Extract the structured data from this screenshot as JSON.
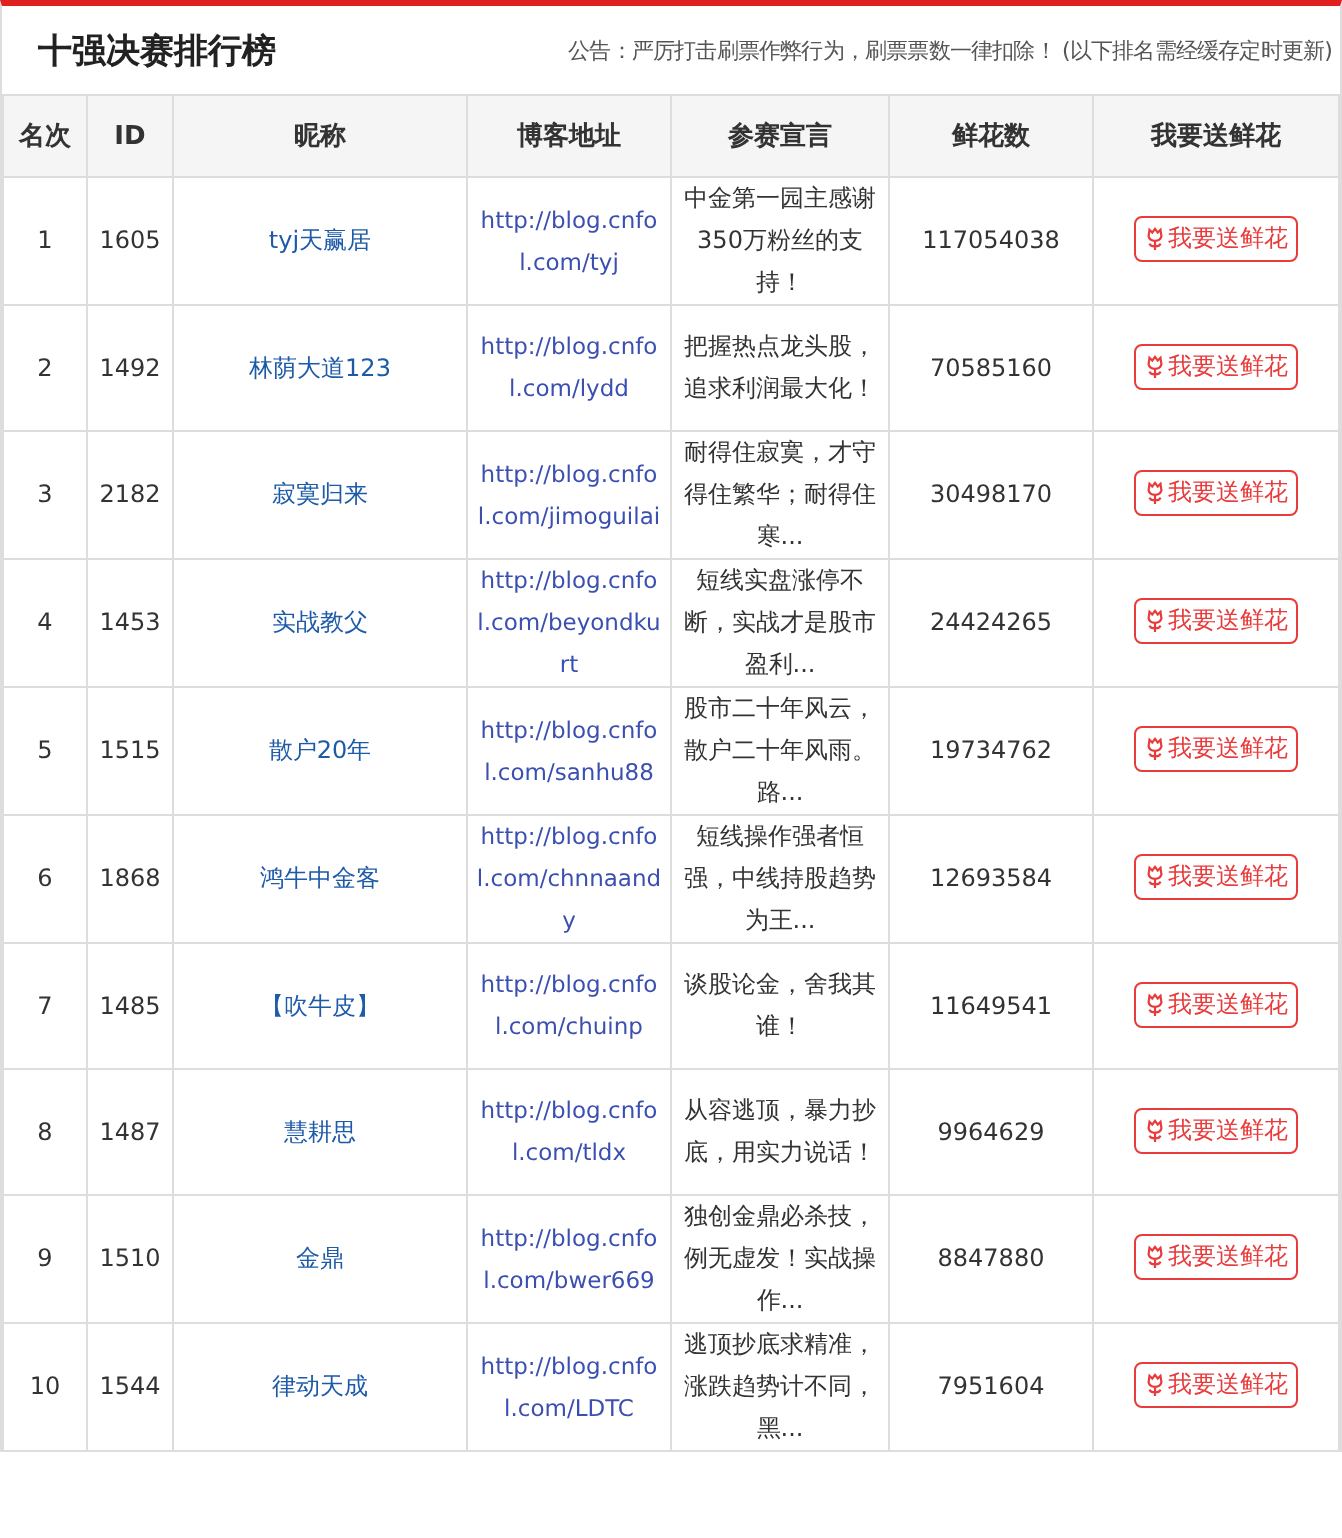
{
  "title": "十强决赛排行榜",
  "notice": "公告：严厉打击刷票作弊行为，刷票票数一律扣除！ (以下排名需经缓存定时更新)",
  "table": {
    "columns": [
      "名次",
      "ID",
      "昵称",
      "博客地址",
      "参赛宣言",
      "鲜花数",
      "我要送鲜花"
    ],
    "rows": [
      {
        "rank": "1",
        "id": "1605",
        "nickname": "tyj天赢居",
        "blog_url": "http://blog.cnfol.com/tyj",
        "declaration": "中金第一园主感谢350万粉丝的支持！",
        "flowers": "117054038",
        "action": "我要送鲜花"
      },
      {
        "rank": "2",
        "id": "1492",
        "nickname": "林荫大道123",
        "blog_url": "http://blog.cnfol.com/lydd",
        "declaration": "把握热点龙头股，追求利润最大化！",
        "flowers": "70585160",
        "action": "我要送鲜花"
      },
      {
        "rank": "3",
        "id": "2182",
        "nickname": "寂寞归来",
        "blog_url": "http://blog.cnfol.com/jimoguilai",
        "declaration": "耐得住寂寞，才守得住繁华；耐得住寒...",
        "flowers": "30498170",
        "action": "我要送鲜花"
      },
      {
        "rank": "4",
        "id": "1453",
        "nickname": "实战教父",
        "blog_url": "http://blog.cnfol.com/beyondkurt",
        "declaration": "短线实盘涨停不断，实战才是股市盈利...",
        "flowers": "24424265",
        "action": "我要送鲜花"
      },
      {
        "rank": "5",
        "id": "1515",
        "nickname": "散户20年",
        "blog_url": "http://blog.cnfol.com/sanhu88",
        "declaration": "股市二十年风云，散户二十年风雨。路...",
        "flowers": "19734762",
        "action": "我要送鲜花"
      },
      {
        "rank": "6",
        "id": "1868",
        "nickname": "鸿牛中金客",
        "blog_url": "http://blog.cnfol.com/chnnaandy",
        "declaration": "短线操作强者恒强，中线持股趋势为王...",
        "flowers": "12693584",
        "action": "我要送鲜花"
      },
      {
        "rank": "7",
        "id": "1485",
        "nickname": "【吹牛皮】",
        "blog_url": "http://blog.cnfol.com/chuinp",
        "declaration": "谈股论金，舍我其谁！",
        "flowers": "11649541",
        "action": "我要送鲜花"
      },
      {
        "rank": "8",
        "id": "1487",
        "nickname": "慧耕思",
        "blog_url": "http://blog.cnfol.com/tldx",
        "declaration": "从容逃顶，暴力抄底，用实力说话！",
        "flowers": "9964629",
        "action": "我要送鲜花"
      },
      {
        "rank": "9",
        "id": "1510",
        "nickname": "金鼎",
        "blog_url": "http://blog.cnfol.com/bwer669",
        "declaration": "独创金鼎必杀技，例无虚发！实战操作...",
        "flowers": "8847880",
        "action": "我要送鲜花"
      },
      {
        "rank": "10",
        "id": "1544",
        "nickname": "律动天成",
        "blog_url": "http://blog.cnfol.com/LDTC",
        "declaration": "逃顶抄底求精准，涨跌趋势计不同，黑...",
        "flowers": "7951604",
        "action": "我要送鲜花"
      }
    ]
  }
}
